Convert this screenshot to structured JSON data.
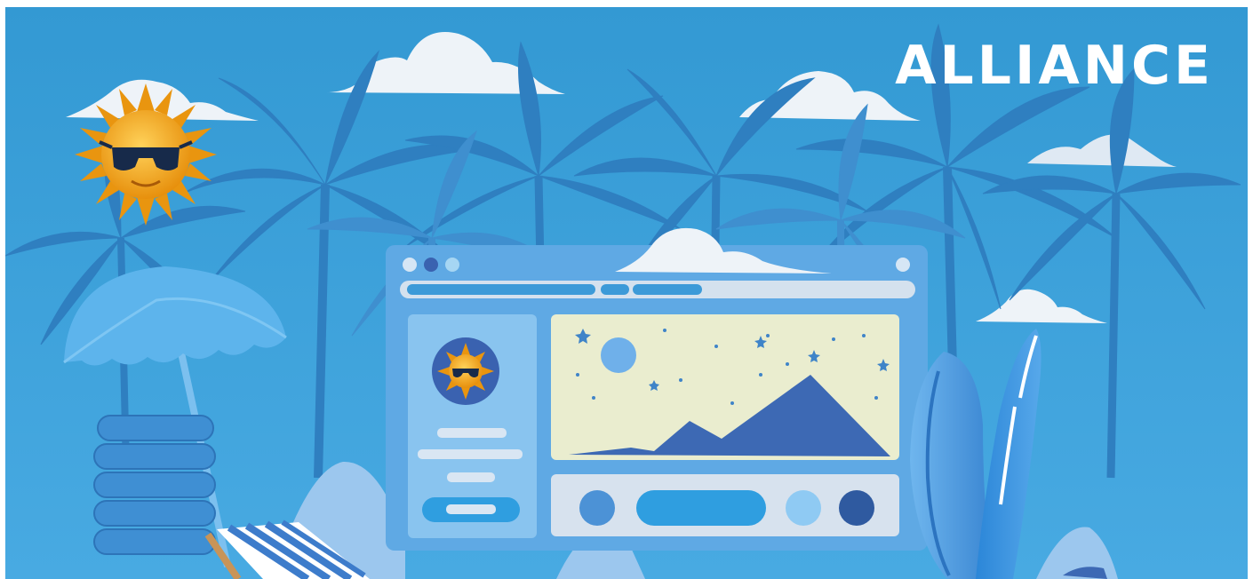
{
  "brand": {
    "logo_text": "ALLIANCE"
  },
  "palette": {
    "background": "#3a9bd6",
    "palm_dark": "#2f7fc0",
    "palm_mid": "#3f8fcf",
    "cloud": "#eef3f8",
    "sun": "#f2a516",
    "browser_frame": "#5fa9e4",
    "canvas_panel": "#eaedcf",
    "mountain": "#3d69b4",
    "accent_blue": "#2f9ee0"
  },
  "icons": [
    "sun-with-sunglasses-icon",
    "cloud-icon",
    "palm-tree-icon",
    "beach-umbrella-icon",
    "deck-chair-icon",
    "surfboard-icon",
    "mountain-landscape-icon",
    "star-icon"
  ]
}
